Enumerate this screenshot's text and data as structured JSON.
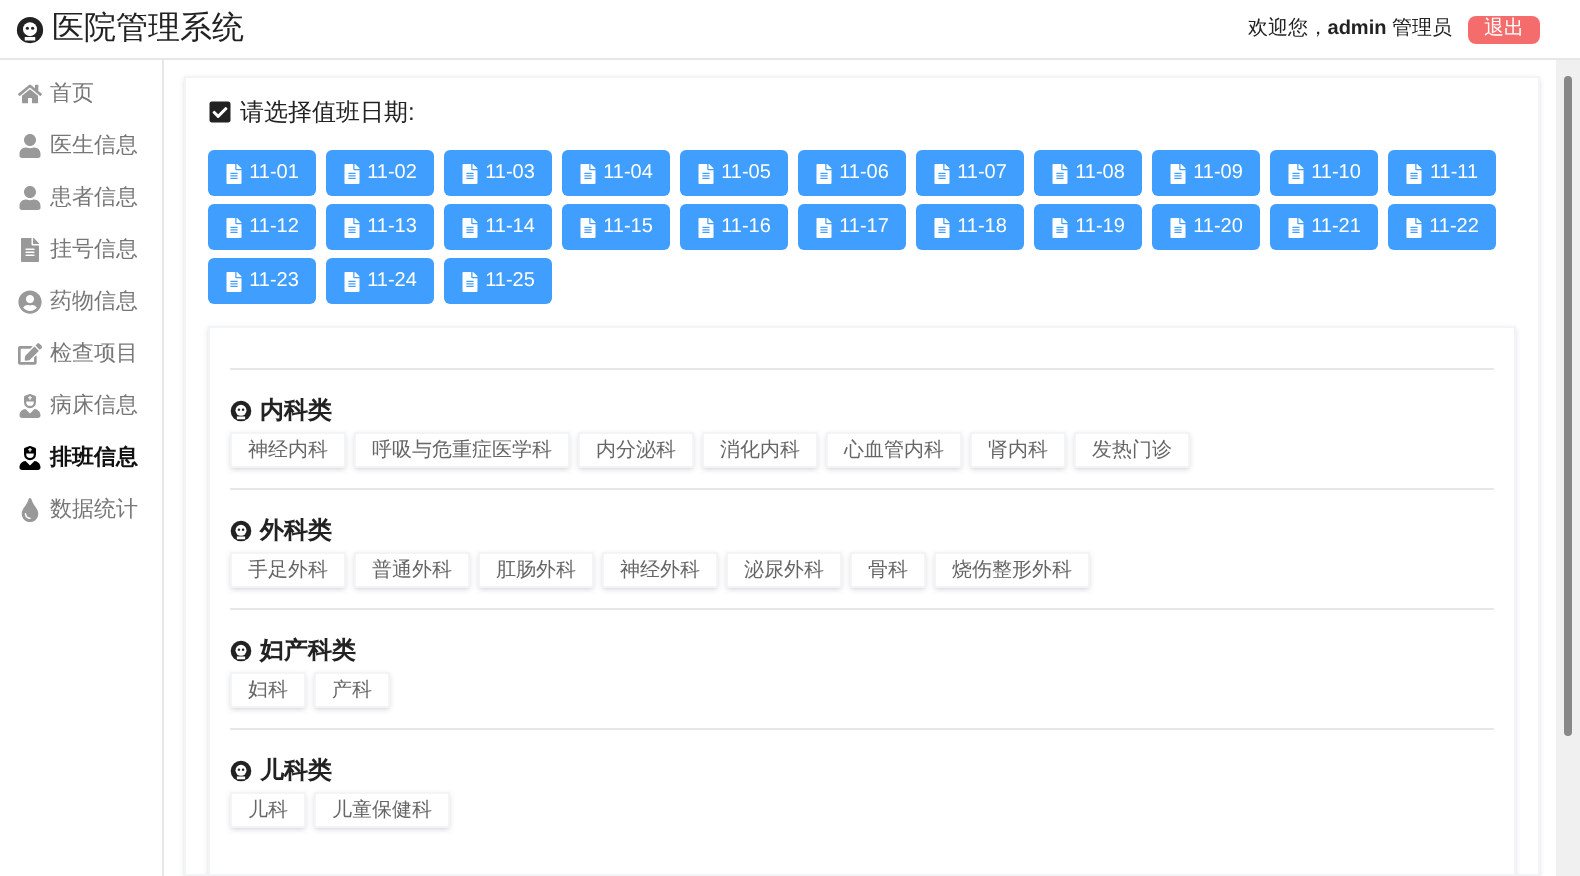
{
  "app": {
    "title": "医院管理系统"
  },
  "header": {
    "greeting": "欢迎您，",
    "user": "admin",
    "role": "管理员",
    "logout": "退出"
  },
  "sidebar": {
    "items": [
      {
        "label": "首页",
        "selected": false
      },
      {
        "label": "医生信息",
        "selected": false
      },
      {
        "label": "患者信息",
        "selected": false
      },
      {
        "label": "挂号信息",
        "selected": false
      },
      {
        "label": "药物信息",
        "selected": false
      },
      {
        "label": "检查项目",
        "selected": false
      },
      {
        "label": "病床信息",
        "selected": false
      },
      {
        "label": "排班信息",
        "selected": true
      },
      {
        "label": "数据统计",
        "selected": false
      }
    ]
  },
  "schedule": {
    "prompt": "请选择值班日期:",
    "dates": [
      "11-01",
      "11-02",
      "11-03",
      "11-04",
      "11-05",
      "11-06",
      "11-07",
      "11-08",
      "11-09",
      "11-10",
      "11-11",
      "11-12",
      "11-13",
      "11-14",
      "11-15",
      "11-16",
      "11-17",
      "11-18",
      "11-19",
      "11-20",
      "11-21",
      "11-22",
      "11-23",
      "11-24",
      "11-25"
    ]
  },
  "departments": [
    {
      "title": "内科类",
      "items": [
        "神经内科",
        "呼吸与危重症医学科",
        "内分泌科",
        "消化内科",
        "心血管内科",
        "肾内科",
        "发热门诊"
      ]
    },
    {
      "title": "外科类",
      "items": [
        "手足外科",
        "普通外科",
        "肛肠外科",
        "神经外科",
        "泌尿外科",
        "骨科",
        "烧伤整形外科"
      ]
    },
    {
      "title": "妇产科类",
      "items": [
        "妇科",
        "产科"
      ]
    },
    {
      "title": "儿科类",
      "items": [
        "儿科",
        "儿童保健科"
      ]
    }
  ]
}
